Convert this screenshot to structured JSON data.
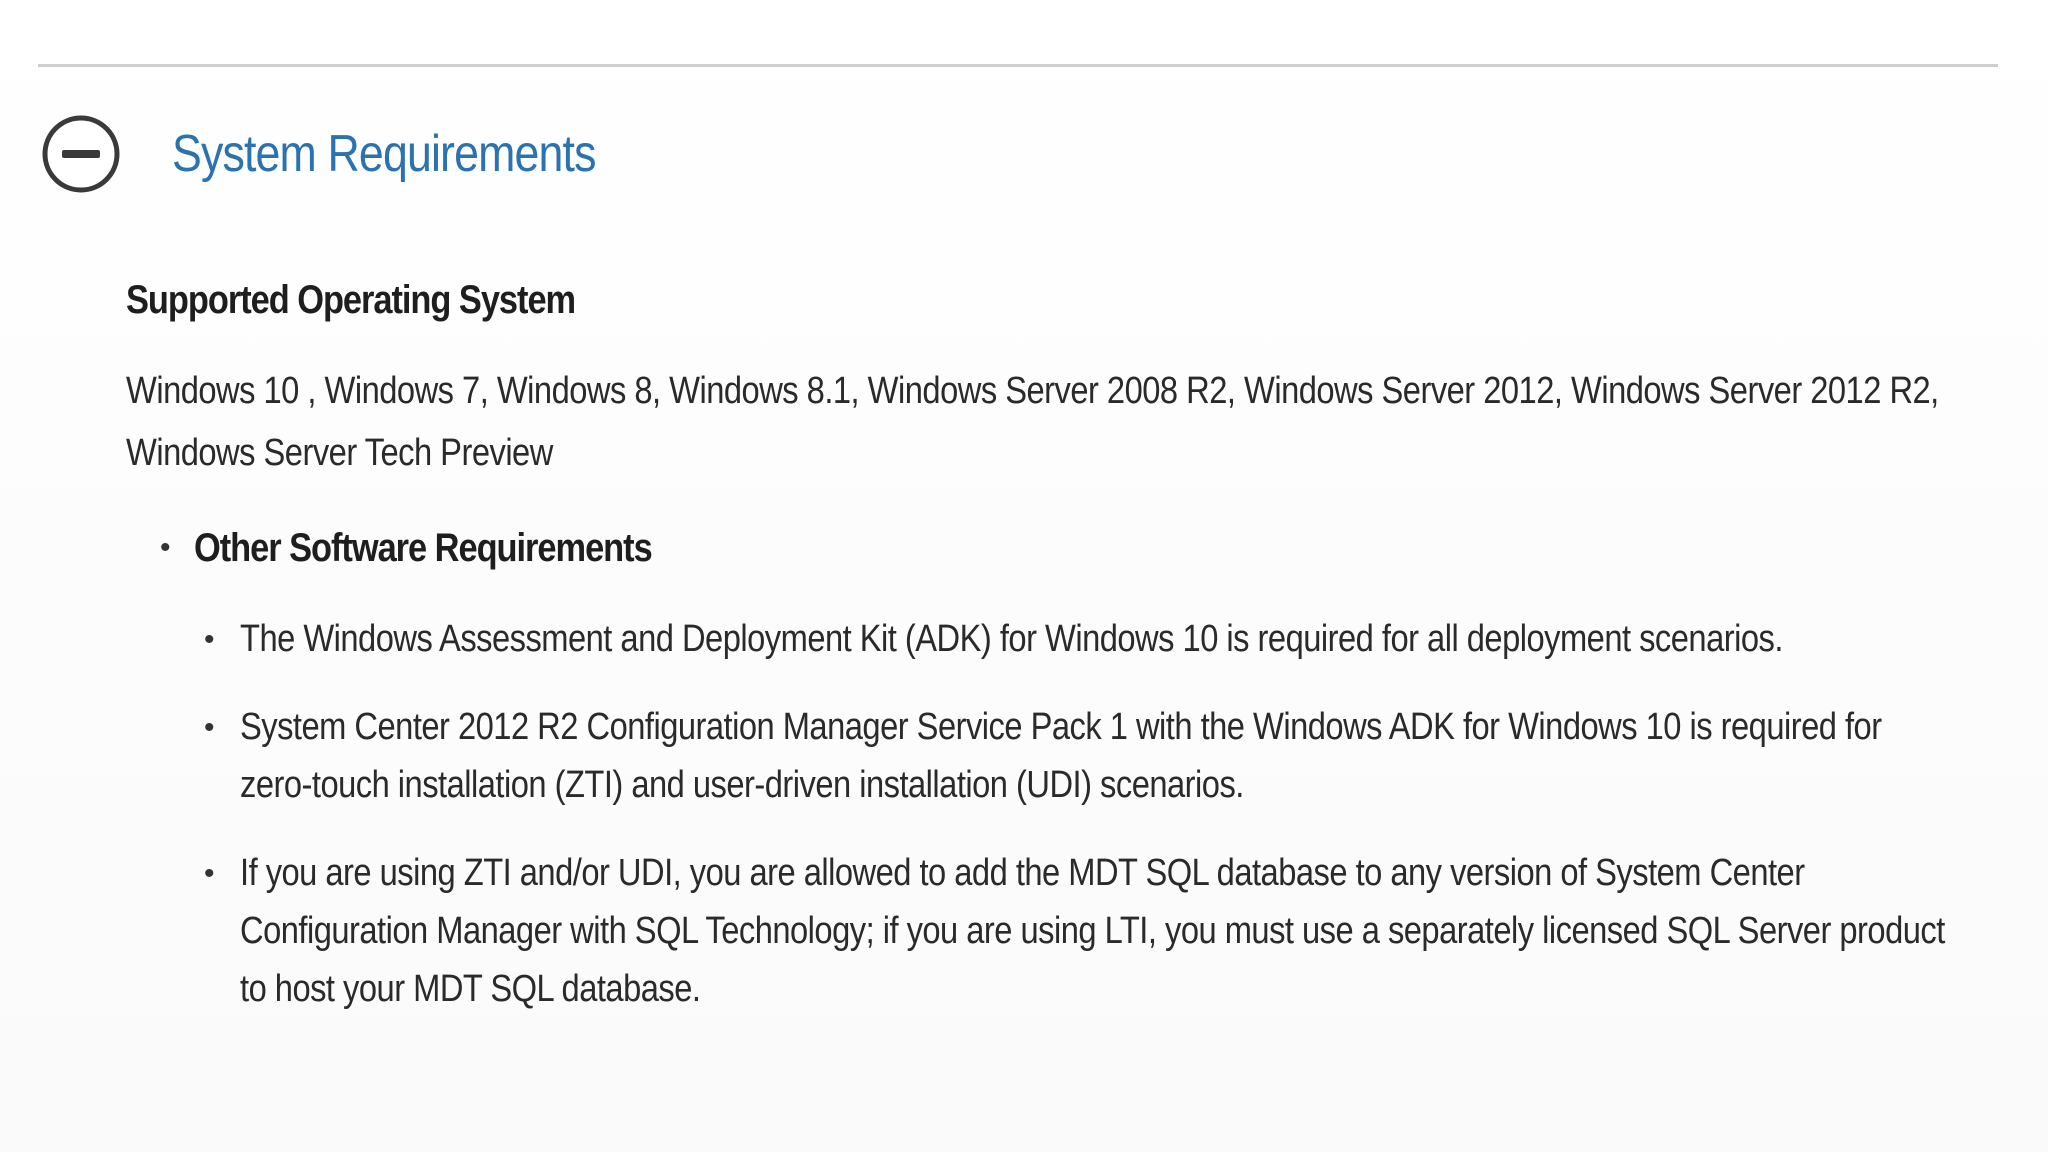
{
  "section": {
    "title": "System Requirements",
    "toggle_icon": "minus-circle-icon"
  },
  "supported_os": {
    "heading": "Supported Operating System",
    "text": "Windows 10 , Windows 7, Windows 8, Windows 8.1, Windows Server 2008 R2, Windows Server 2012, Windows Server 2012 R2, Windows Server Tech Preview"
  },
  "other_software": {
    "bullet": "•",
    "heading": "Other Software Requirements",
    "items": [
      "The Windows Assessment and Deployment Kit (ADK) for Windows 10 is required for all deployment scenarios.",
      "System Center 2012 R2 Configuration Manager Service Pack 1 with the Windows ADK for Windows 10 is required for zero-touch installation (ZTI) and user-driven installation (UDI) scenarios.",
      "If you are using ZTI and/or UDI, you are allowed to add the MDT SQL database to any version of System Center Configuration Manager with SQL Technology; if you are using LTI, you must use a separately licensed SQL Server product to host your MDT SQL database."
    ]
  },
  "colors": {
    "title": "#2b72b0",
    "rule": "#cfcfcf",
    "text": "#2a2a2a"
  }
}
